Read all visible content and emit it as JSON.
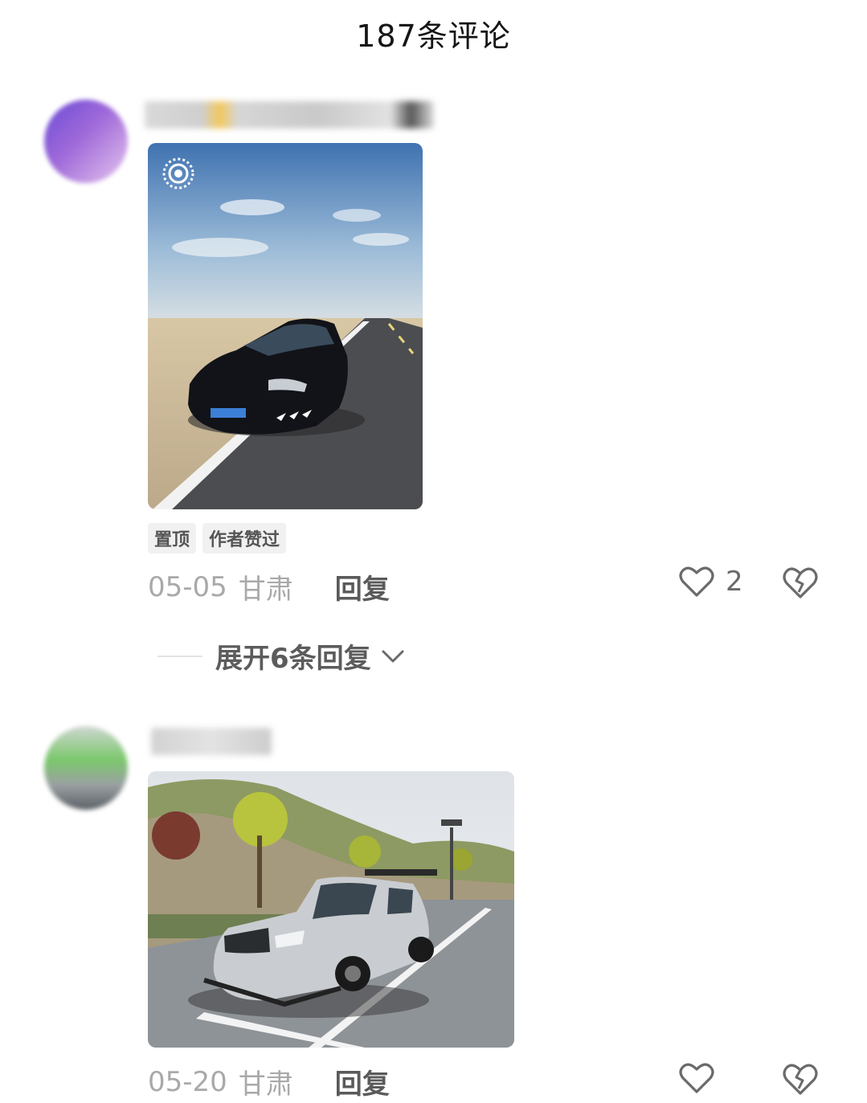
{
  "header": {
    "title": "187条评论"
  },
  "comments": [
    {
      "tags": [
        "置顶",
        "作者赞过"
      ],
      "date": "05-05",
      "location": "甘肃",
      "reply_label": "回复",
      "like_count": "2",
      "expand_label": "展开6条回复"
    },
    {
      "date": "05-20",
      "location": "甘肃",
      "reply_label": "回复"
    }
  ],
  "icons": {
    "like": "heart-outline-icon",
    "dislike": "broken-heart-icon",
    "live_photo": "live-photo-icon",
    "expand": "chevron-down-icon"
  }
}
